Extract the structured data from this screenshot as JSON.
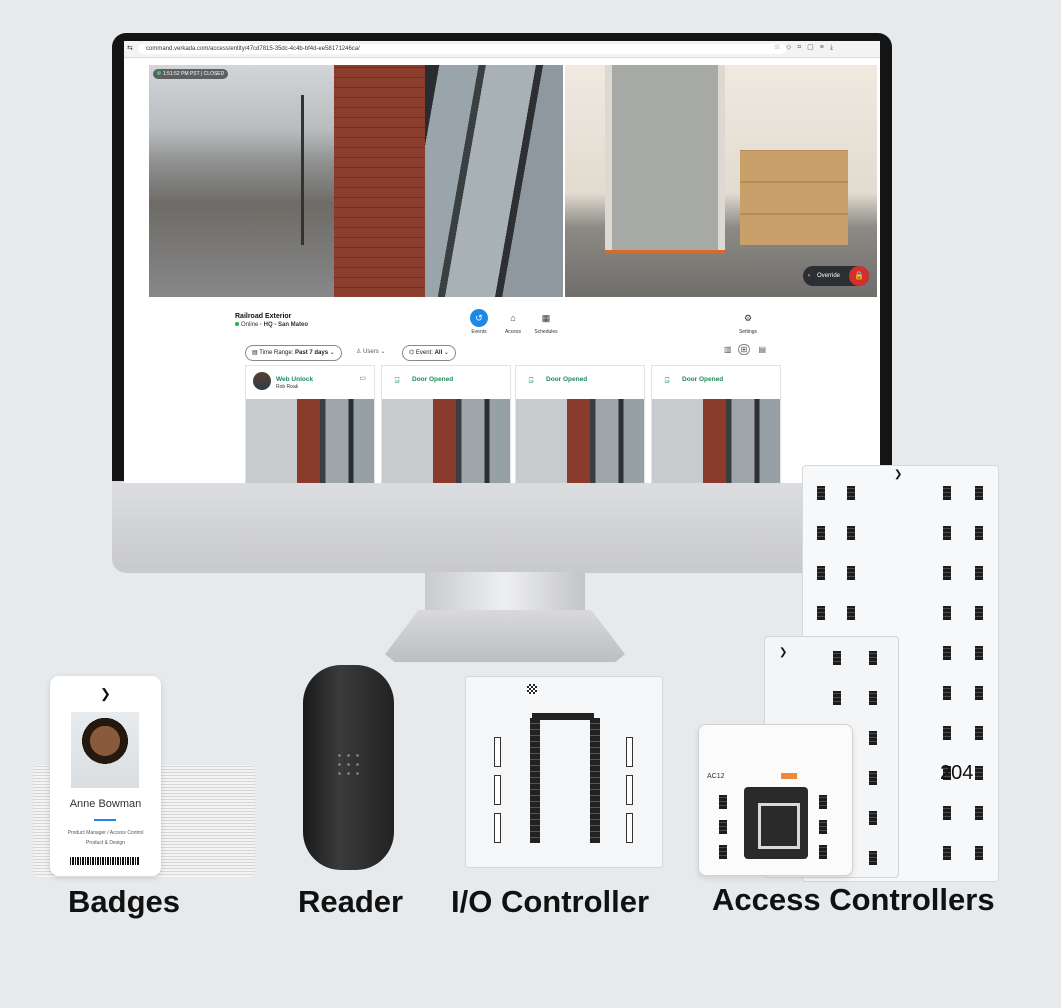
{
  "browser": {
    "url": "command.verkada.com/access/entity/47cd7815-35dc-4c4b-bf4d-ee58171246ca/",
    "icons": [
      "star-icon",
      "extension-icon",
      "cast-icon",
      "tab-icon",
      "reading-list-icon",
      "download-icon"
    ]
  },
  "camera": {
    "timestamp": "1:51:52 PM PST | CLOSED",
    "override_label": "Override"
  },
  "site": {
    "name": "Railroad Exterior",
    "status": "Online",
    "location": "· HQ - San Mateo"
  },
  "nav": {
    "tabs": [
      {
        "label": "Events",
        "active": true
      },
      {
        "label": "Access",
        "active": false
      },
      {
        "label": "Schedules",
        "active": false
      }
    ],
    "settings_label": "Settings"
  },
  "filters": {
    "time_range_prefix": "Time Range: ",
    "time_range_value": "Past 7 days",
    "users_label": "Users",
    "event_prefix": "Event: ",
    "event_value": "All"
  },
  "events": [
    {
      "title": "Web Unlock",
      "user": "Rob Roak",
      "type": "web-unlock"
    },
    {
      "title": "Door Opened",
      "user": "",
      "type": "door"
    },
    {
      "title": "Door Opened",
      "user": "",
      "type": "door"
    },
    {
      "title": "Door Opened",
      "user": "",
      "type": "door"
    }
  ],
  "badge": {
    "name": "Anne Bowman",
    "role": "Product Manager / Access Control",
    "team": "Product & Design"
  },
  "devices": {
    "ac12_label": "AC12",
    "number_overlay": "204"
  },
  "captions": {
    "badges": "Badges",
    "reader": "Reader",
    "io": "I/O Controller",
    "access": "Access Controllers"
  },
  "colors": {
    "accent": "#1e88e5",
    "success": "#1d8a5a",
    "danger": "#d32f2f"
  }
}
